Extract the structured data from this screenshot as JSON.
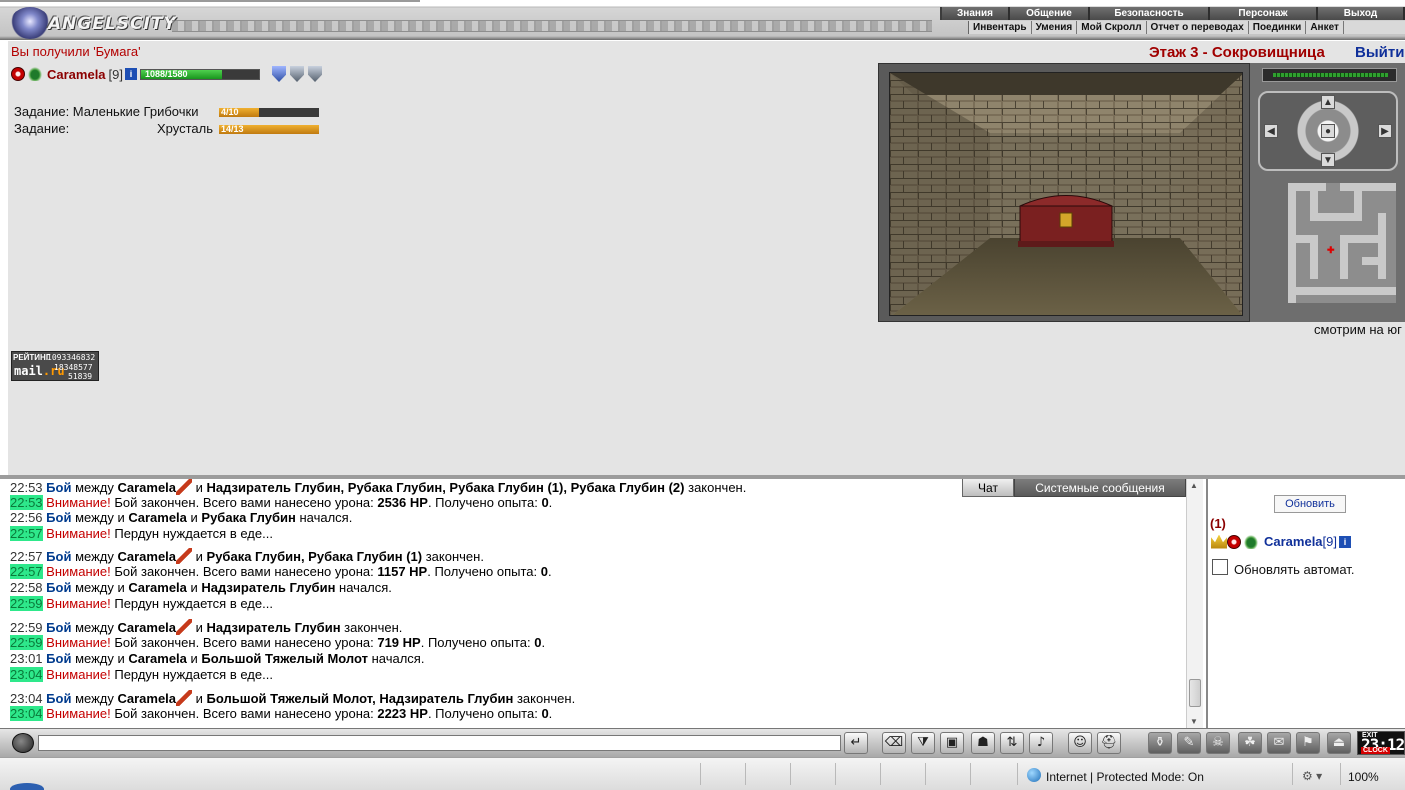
{
  "header": {
    "logo_text": "ANGELSCITY",
    "nav_top": [
      "Знания",
      "Общение",
      "Безопасность",
      "Персонаж",
      "Выход"
    ],
    "nav_bottom": [
      "Инвентарь",
      "Умения",
      "Мой Скролл",
      "Отчет о переводах",
      "Поединки",
      "Анкет"
    ]
  },
  "notice": "Вы получили 'Бумага'",
  "player": {
    "name": "Caramela",
    "level": "[9]",
    "info_badge": "i",
    "hp_text": "1088/1580",
    "hp_current": 1088,
    "hp_max": 1580
  },
  "tasks": [
    {
      "label": "Задание: Маленькие Грибочки",
      "progress": "4/10",
      "fraction": 0.4
    },
    {
      "label": "Задание:",
      "item": "Хрусталь",
      "progress": "14/13",
      "fraction": 1.0
    }
  ],
  "location": {
    "floor_title": "Этаж 3 - Сокровищница",
    "exit_label": "Выйти",
    "facing": "смотрим на юг"
  },
  "rating": {
    "label": "РЕЙТИНГ",
    "brand": "mail",
    "brand_suffix": ".ru",
    "n1": "1093346832",
    "n2": "18348577",
    "n3": "51839"
  },
  "chat": {
    "tabs": [
      "Чат",
      "Системные сообщения"
    ],
    "lines": [
      {
        "time": "22:53",
        "hl": false,
        "kind": "fight",
        "label": "Бой",
        "text1": " между ",
        "name1": "Caramela",
        "sword": true,
        "text2": " и ",
        "name2": "Надзиратель Глубин, Рубака Глубин, Рубака Глубин (1), Рубака Глубин (2)",
        "text3": " закончен."
      },
      {
        "time": "22:53",
        "hl": true,
        "kind": "warn",
        "label": "Внимание!",
        "text1": " Бой закончен. Всего вами нанесено урона: ",
        "name1": "2536 HP",
        "text2": ". Получено опыта: ",
        "name2": "0",
        "text3": "."
      },
      {
        "time": "22:56",
        "hl": false,
        "kind": "fight",
        "label": "Бой",
        "text1": " между и ",
        "name1": "Caramela",
        "text2": " и ",
        "name2": "Рубака Глубин",
        "text3": " начался."
      },
      {
        "time": "22:57",
        "hl": true,
        "kind": "warn",
        "label": "Внимание!",
        "text1": " Пердун нуждается в еде...",
        "name1": "",
        "text2": "",
        "name2": "",
        "text3": ""
      },
      {
        "time": "22:57",
        "hl": false,
        "kind": "fight",
        "label": "Бой",
        "text1": " между ",
        "name1": "Caramela",
        "sword": true,
        "text2": " и ",
        "name2": "Рубака Глубин, Рубака Глубин (1)",
        "text3": " закончен."
      },
      {
        "time": "22:57",
        "hl": true,
        "kind": "warn",
        "label": "Внимание!",
        "text1": " Бой закончен. Всего вами нанесено урона: ",
        "name1": "1157 HP",
        "text2": ". Получено опыта: ",
        "name2": "0",
        "text3": "."
      },
      {
        "time": "22:58",
        "hl": false,
        "kind": "fight",
        "label": "Бой",
        "text1": " между и ",
        "name1": "Caramela",
        "text2": " и ",
        "name2": "Надзиратель Глубин",
        "text3": " начался."
      },
      {
        "time": "22:59",
        "hl": true,
        "kind": "warn",
        "label": "Внимание!",
        "text1": " Пердун нуждается в еде...",
        "name1": "",
        "text2": "",
        "name2": "",
        "text3": ""
      },
      {
        "time": "22:59",
        "hl": false,
        "kind": "fight",
        "label": "Бой",
        "text1": " между ",
        "name1": "Caramela",
        "sword": true,
        "text2": " и ",
        "name2": "Надзиратель Глубин",
        "text3": " закончен."
      },
      {
        "time": "22:59",
        "hl": true,
        "kind": "warn",
        "label": "Внимание!",
        "text1": " Бой закончен. Всего вами нанесено урона: ",
        "name1": "719 HP",
        "text2": ". Получено опыта: ",
        "name2": "0",
        "text3": "."
      },
      {
        "time": "23:01",
        "hl": false,
        "kind": "fight",
        "label": "Бой",
        "text1": " между и ",
        "name1": "Caramela",
        "text2": " и ",
        "name2": "Большой Тяжелый Молот",
        "text3": " начался."
      },
      {
        "time": "23:04",
        "hl": true,
        "kind": "warn",
        "label": "Внимание!",
        "text1": " Пердун нуждается в еде...",
        "name1": "",
        "text2": "",
        "name2": "",
        "text3": ""
      },
      {
        "time": "23:04",
        "hl": false,
        "kind": "fight",
        "label": "Бой",
        "text1": " между ",
        "name1": "Caramela",
        "sword": true,
        "text2": " и ",
        "name2": "Большой Тяжелый Молот, Надзиратель Глубин",
        "text3": " закончен."
      },
      {
        "time": "23:04",
        "hl": true,
        "kind": "warn",
        "label": "Внимание!",
        "text1": " Бой закончен. Всего вами нанесено урона: ",
        "name1": "2223 HP",
        "text2": ". Получено опыта: ",
        "name2": "0",
        "text3": "."
      }
    ]
  },
  "online": {
    "refresh_label": "Обновить",
    "count": "(1)",
    "name": "Caramela",
    "level": "[9]",
    "info_badge": "i",
    "auto_label": "Обновлять автомат."
  },
  "toolbar": {
    "input_value": "",
    "clock_exit": "EXIT",
    "clock_time": "23:12",
    "clock_label": "CLOCK"
  },
  "statusbar": {
    "zone": "Internet | Protected Mode: On",
    "zoom": "100%"
  }
}
